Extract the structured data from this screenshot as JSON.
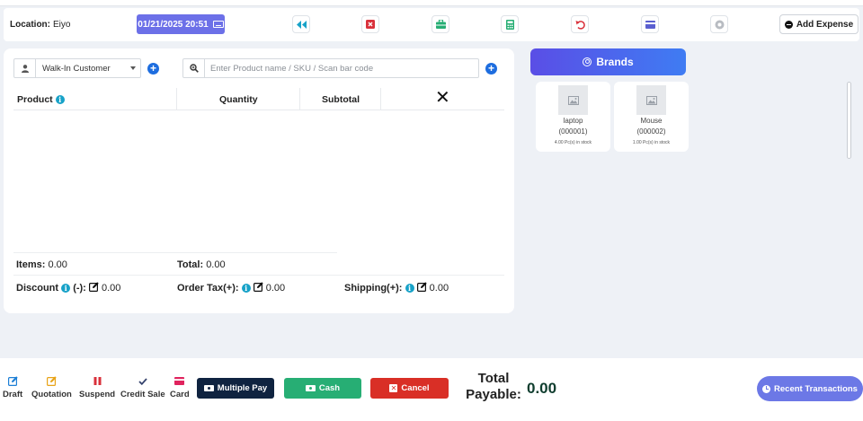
{
  "header": {
    "location_label": "Location:",
    "location_value": "Eiyo",
    "datetime": "01/21/2025 20:51",
    "add_expense_label": "Add Expense",
    "icons": [
      "rewind-icon",
      "close-box-icon",
      "briefcase-icon",
      "calculator-icon",
      "undo-icon",
      "credit-card-icon",
      "pause-circle-icon"
    ],
    "colors": {
      "datetime_bg": "#6c70e8"
    }
  },
  "customer": {
    "selected": "Walk-In Customer"
  },
  "search": {
    "placeholder": "Enter Product name / SKU / Scan bar code"
  },
  "table": {
    "columns": {
      "product": "Product",
      "quantity": "Quantity",
      "subtotal": "Subtotal"
    },
    "rows": []
  },
  "summary": {
    "items_label": "Items:",
    "items_value": "0.00",
    "total_label": "Total:",
    "total_value": "0.00",
    "discount_label": "Discount",
    "discount_suffix": "(-):",
    "discount_value": "0.00",
    "order_tax_label": "Order Tax(+):",
    "order_tax_value": "0.00",
    "shipping_label": "Shipping(+):",
    "shipping_value": "0.00"
  },
  "brands": {
    "button_label": "Brands",
    "products": [
      {
        "name": "laptop",
        "sku": "(000001)",
        "stock": "4.00 Pc(s) in stock"
      },
      {
        "name": "Mouse",
        "sku": "(000002)",
        "stock": "1.00 Pc(s) in stock"
      }
    ]
  },
  "bottom": {
    "actions": [
      {
        "label": "Draft",
        "color": "#1d7fd6"
      },
      {
        "label": "Quotation",
        "color": "#e8a317"
      },
      {
        "label": "Suspend",
        "color": "#d9313b"
      },
      {
        "label": "Credit Sale",
        "color": "#36446e"
      },
      {
        "label": "Card",
        "color": "#e0245e"
      }
    ],
    "multiple_pay": "Multiple Pay",
    "cash": "Cash",
    "cancel": "Cancel",
    "total_payable_label": "Total Payable:",
    "total_payable_value": "0.00",
    "recent_transactions": "Recent Transactions",
    "colors": {
      "multiple_pay": "#0f2340",
      "cash": "#27ae74",
      "cancel": "#d92f26",
      "recent": "#6c78e6"
    }
  }
}
